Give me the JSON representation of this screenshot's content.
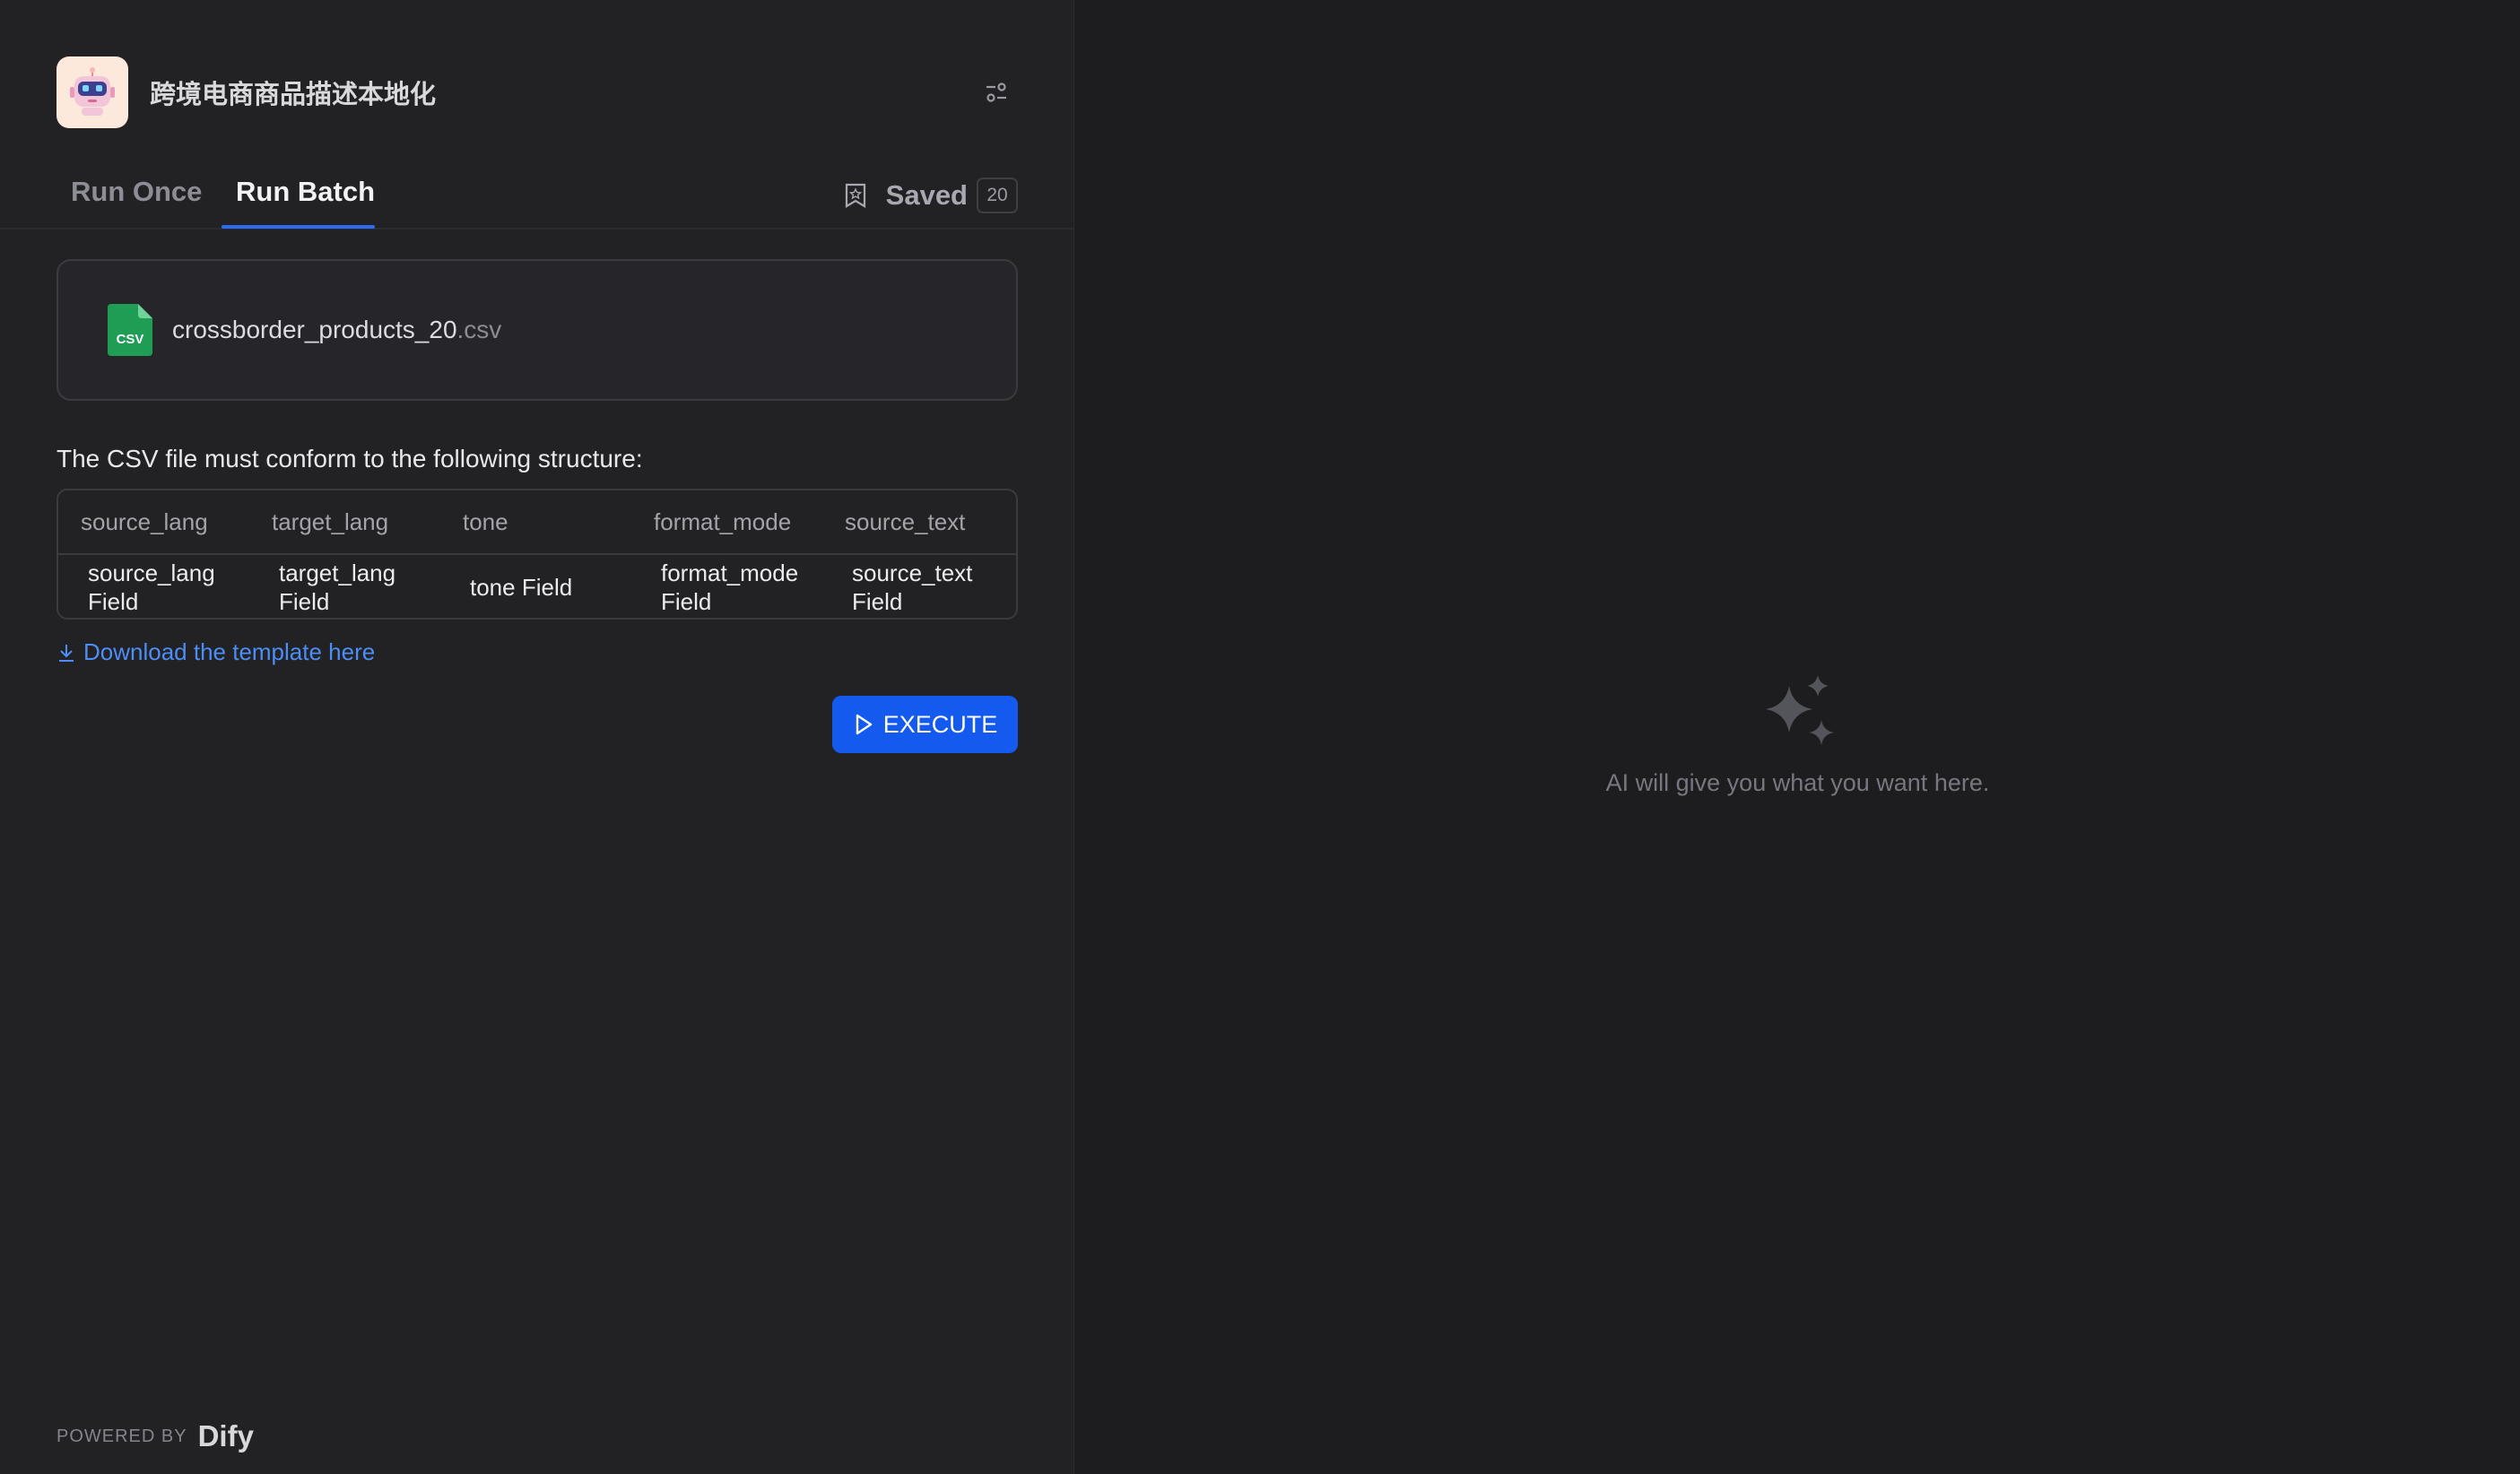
{
  "app": {
    "title": "跨境电商商品描述本地化"
  },
  "tabs": [
    {
      "label": "Run Once",
      "active": false
    },
    {
      "label": "Run Batch",
      "active": true
    }
  ],
  "saved": {
    "label": "Saved",
    "count": "20"
  },
  "upload": {
    "file_icon_text": "CSV",
    "file_name": "crossborder_products_20",
    "file_ext": ".csv"
  },
  "structure": {
    "label": "The CSV file must conform to the following structure:",
    "headers": [
      "source_lang",
      "target_lang",
      "tone",
      "format_mode",
      "source_text"
    ],
    "row": [
      "source_lang Field",
      "target_lang Field",
      "tone Field",
      "format_mode Field",
      "source_text Field"
    ]
  },
  "download": {
    "label": "Download the template here"
  },
  "execute": {
    "label": "EXECUTE"
  },
  "footer": {
    "powered_by": "POWERED BY",
    "brand": "Dify"
  },
  "result": {
    "empty_text": "AI will give you what you want here."
  },
  "colors": {
    "accent": "#155aef",
    "link": "#4c8df6",
    "tab_indicator": "#2e6bf3",
    "csv_icon": "#1f9d55"
  }
}
